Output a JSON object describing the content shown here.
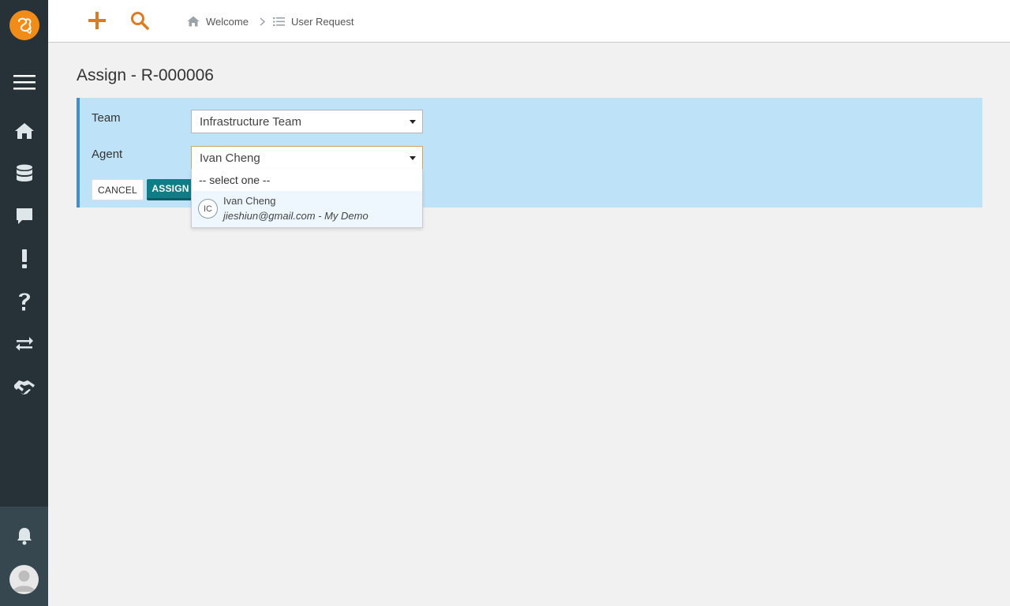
{
  "app": {
    "colors": {
      "accent": "#e07a1f",
      "sidebar": "#263238",
      "panel": "#bee3f8",
      "primary_button": "#0f7d86"
    }
  },
  "topbar": {
    "new_icon": "plus-icon",
    "search_icon": "search-icon",
    "breadcrumb": [
      {
        "label": "Welcome",
        "icon": "home-icon"
      },
      {
        "label": "User Request",
        "icon": "list-icon"
      }
    ]
  },
  "sidebar": {
    "items": [
      {
        "name": "menu",
        "icon": "hamburger-menu-icon"
      },
      {
        "name": "home",
        "icon": "home-icon"
      },
      {
        "name": "database",
        "icon": "database-icon"
      },
      {
        "name": "messages",
        "icon": "chat-icon"
      },
      {
        "name": "incidents",
        "icon": "exclamation-icon"
      },
      {
        "name": "help",
        "icon": "question-icon"
      },
      {
        "name": "changes",
        "icon": "transfer-icon"
      },
      {
        "name": "agreements",
        "icon": "handshake-icon"
      }
    ],
    "bottom": [
      {
        "name": "notifications",
        "icon": "bell-icon"
      },
      {
        "name": "profile",
        "icon": "avatar-icon"
      }
    ]
  },
  "page": {
    "title": "Assign - R-000006"
  },
  "form": {
    "team_label": "Team",
    "team_value": "Infrastructure Team",
    "agent_label": "Agent",
    "agent_value": "Ivan Cheng",
    "cancel_label": "CANCEL",
    "assign_label": "ASSIGN"
  },
  "agent_dropdown": {
    "placeholder": "-- select one --",
    "options": [
      {
        "initials": "IC",
        "name": "Ivan Cheng",
        "subtitle": "jieshiun@gmail.com - My Demo"
      }
    ]
  }
}
